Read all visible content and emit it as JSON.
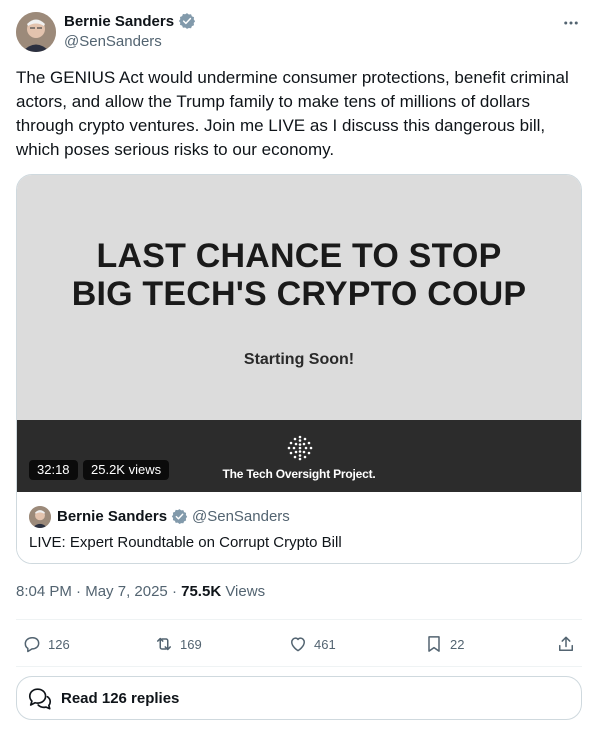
{
  "author": {
    "name": "Bernie Sanders",
    "handle": "@SenSanders",
    "verified_color": "#829aab"
  },
  "tweet": {
    "text": "The GENIUS Act would undermine consumer protections, benefit criminal actors, and allow the Trump family to make tens of millions of dollars through crypto ventures. Join me LIVE as I discuss this dangerous bill, which poses serious risks to our economy."
  },
  "video": {
    "headline_line1": "LAST CHANCE TO STOP",
    "headline_line2": "BIG TECH'S CRYPTO COUP",
    "subtitle": "Starting Soon!",
    "org_name": "The Tech Oversight Project.",
    "duration": "32:18",
    "views": "25.2K views"
  },
  "quote": {
    "name": "Bernie Sanders",
    "handle": "@SenSanders",
    "text": "LIVE: Expert Roundtable on Corrupt Crypto Bill"
  },
  "meta": {
    "time": "8:04 PM",
    "date": "May 7, 2025",
    "views_count": "75.5K",
    "views_label": "Views"
  },
  "actions": {
    "replies": "126",
    "reposts": "169",
    "likes": "461",
    "bookmarks": "22"
  },
  "read_replies": {
    "label": "Read 126 replies"
  },
  "colors": {
    "text_primary": "#0f1419",
    "text_secondary": "#536471",
    "border": "#cfd9de",
    "video_bg": "#dcdcdc",
    "video_footer": "#2c2c2c"
  }
}
